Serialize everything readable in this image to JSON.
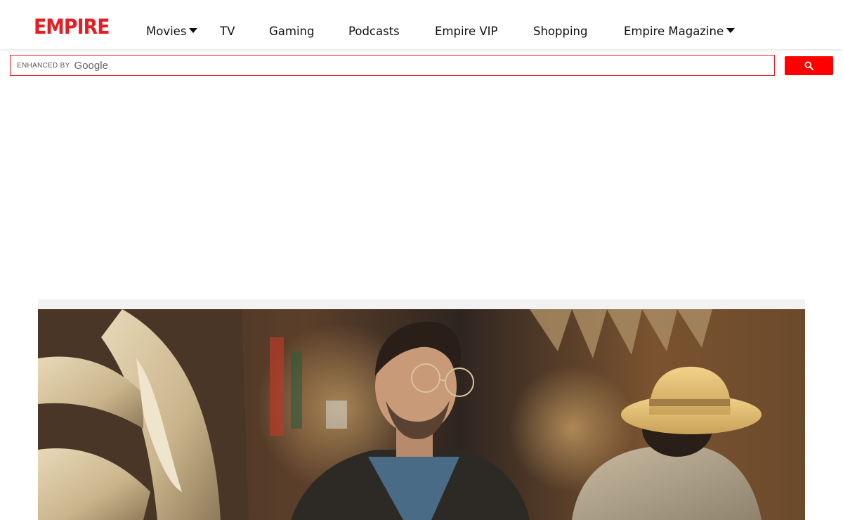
{
  "site": {
    "logo": "EMPIRE",
    "brand_color": "#e31e24"
  },
  "nav": {
    "items": [
      {
        "label": "Movies",
        "has_dropdown": true
      },
      {
        "label": "TV",
        "has_dropdown": false
      },
      {
        "label": "Gaming",
        "has_dropdown": false
      },
      {
        "label": "Podcasts",
        "has_dropdown": false
      },
      {
        "label": "Empire VIP",
        "has_dropdown": false
      },
      {
        "label": "Shopping",
        "has_dropdown": false
      },
      {
        "label": "Empire Magazine",
        "has_dropdown": true
      }
    ]
  },
  "search": {
    "enhanced_label": "ENHANCED BY",
    "provider_label": "Google",
    "value": "",
    "button_icon": "search-icon",
    "button_color": "#ff0000"
  },
  "hero": {
    "image_icon": "hero-photo"
  }
}
